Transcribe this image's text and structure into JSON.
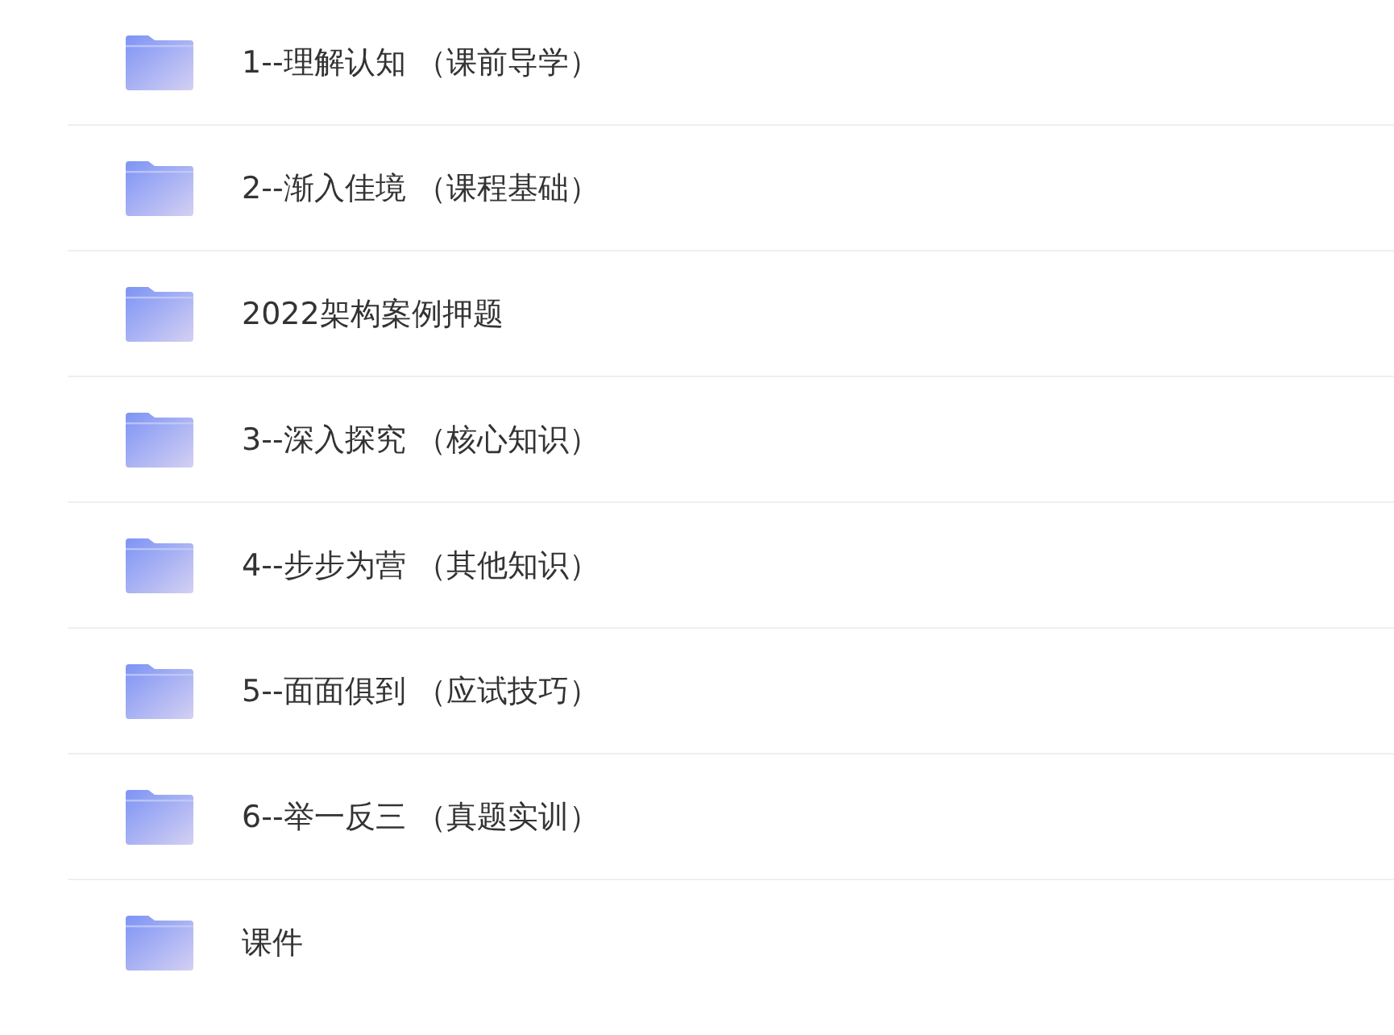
{
  "folders": [
    {
      "kind": "folder",
      "name": "1--理解认知 （课前导学）"
    },
    {
      "kind": "folder",
      "name": "2--渐入佳境 （课程基础）"
    },
    {
      "kind": "folder",
      "name": "2022架构案例押题"
    },
    {
      "kind": "folder",
      "name": "3--深入探究 （核心知识）"
    },
    {
      "kind": "folder",
      "name": "4--步步为营 （其他知识）"
    },
    {
      "kind": "folder",
      "name": "5--面面俱到 （应试技巧）"
    },
    {
      "kind": "folder",
      "name": "6--举一反三 （真题实训）"
    },
    {
      "kind": "folder",
      "name": "课件"
    }
  ]
}
